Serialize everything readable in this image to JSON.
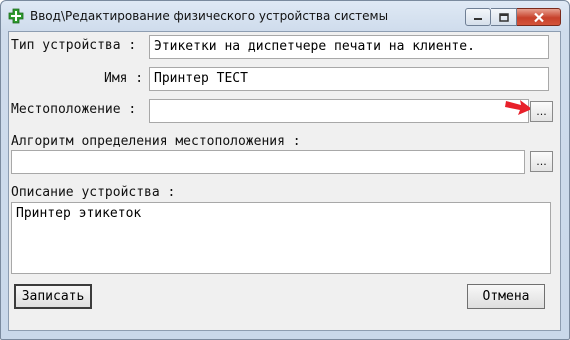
{
  "window": {
    "title": "Ввод\\Редактирование физического устройства системы"
  },
  "form": {
    "device_type": {
      "label": "Тип устройства :",
      "value": "Этикетки на диспетчере печати на клиенте."
    },
    "name": {
      "label": "Имя :",
      "value": "Принтер ТЕСТ"
    },
    "location": {
      "label": "Местоположение :",
      "value": "",
      "browse_label": "..."
    },
    "location_algorithm": {
      "label": "Алгоритм определения местоположения :",
      "value": "",
      "browse_label": "..."
    },
    "description": {
      "label": "Описание устройства :",
      "value": "Принтер этикеток"
    }
  },
  "buttons": {
    "save": "Записать",
    "cancel": "Отмена"
  },
  "colors": {
    "annotation_arrow": "#e8202a",
    "app_icon": "#2e9b2e"
  },
  "icons": [
    "app-plus-icon",
    "minimize-icon",
    "maximize-icon",
    "close-icon",
    "red-arrow-annotation"
  ]
}
